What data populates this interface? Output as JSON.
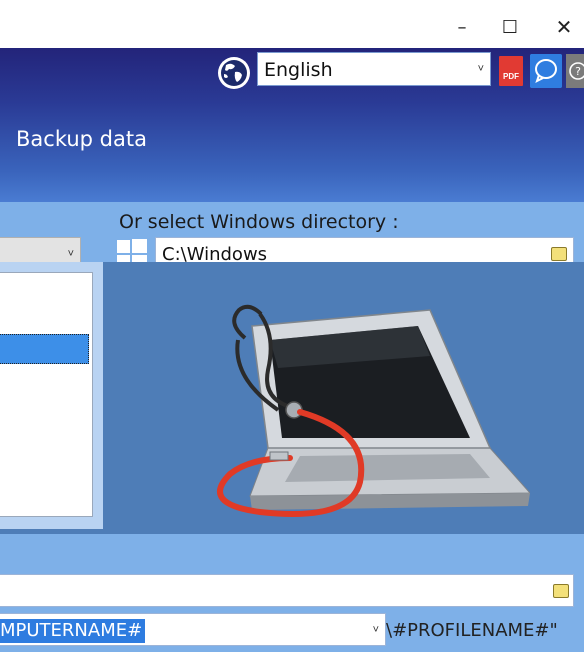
{
  "window": {
    "minimize_glyph": "–",
    "maximize_glyph": "☐",
    "close_glyph": "✕"
  },
  "header": {
    "language": {
      "selected": "English",
      "arrow": "˅"
    },
    "pdf_label": "PDF",
    "title": "Backup data",
    "icons": [
      "globe-icon",
      "pdf-icon",
      "chat-icon",
      "help-icon"
    ]
  },
  "source": {
    "dropdown_arrow": "˅",
    "windows_dir_label": "Or select Windows directory :",
    "windows_dir_value": "C:\\Windows"
  },
  "destination": {
    "path_value": "",
    "template_value": "MPUTERNAME#",
    "template_arrow": "˅",
    "suffix": "\\#PROFILENAME#\""
  },
  "colors": {
    "header_dark": "#23247a",
    "header_light": "#4a7cd2",
    "panel": "#4e7db7",
    "bar": "#7eb0e8",
    "selection": "#2e7ce0"
  }
}
